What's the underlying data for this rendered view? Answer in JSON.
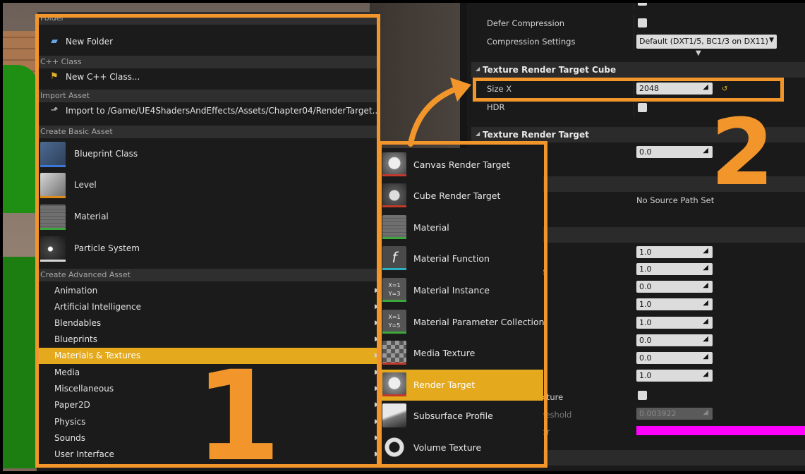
{
  "menu": {
    "sections": {
      "folder": "Folder",
      "cpp_class": "C++ Class",
      "import_asset": "Import Asset",
      "create_basic": "Create Basic Asset",
      "create_advanced": "Create Advanced Asset"
    },
    "new_folder": "New Folder",
    "new_cpp_class": "New C++ Class...",
    "import_to": "Import to /Game/UE4ShadersAndEffects/Assets/Chapter04/RenderTarget...",
    "basic_assets": [
      "Blueprint Class",
      "Level",
      "Material",
      "Particle System"
    ],
    "advanced_categories": [
      "Animation",
      "Artificial Intelligence",
      "Blendables",
      "Blueprints",
      "Materials & Textures",
      "Media",
      "Miscellaneous",
      "Paper2D",
      "Physics",
      "Sounds",
      "User Interface"
    ],
    "selected_category": "Materials & Textures"
  },
  "submenu": {
    "items": [
      "Canvas Render Target",
      "Cube Render Target",
      "Material",
      "Material Function",
      "Material Instance",
      "Material Parameter Collection",
      "Media Texture",
      "Render Target",
      "Subsurface Profile",
      "Volume Texture"
    ],
    "selected": "Render Target"
  },
  "details": {
    "defer_compression": "Defer Compression",
    "compression_settings": "Compression Settings",
    "compression_value": "Default (DXT1/5, BC1/3 on DX11)",
    "cube_category": "Texture Render Target Cube",
    "size_x_label": "Size X",
    "size_x_value": "2048",
    "hdr_label": "HDR",
    "rt_category": "Texture Render Target",
    "rt_value": "0.0",
    "source_path": "No Source Path Set",
    "values": [
      "1.0",
      "1.0",
      "0.0",
      "1.0",
      "1.0",
      "0.0",
      "0.0",
      "1.0"
    ],
    "partial_label_e": "e",
    "partial_texture": "xture",
    "partial_threshold": "reshold",
    "partial_or": "or",
    "threshold_value": "0.003922",
    "color_swatch": "#ff00ff"
  },
  "annotations": {
    "step1": "1",
    "step2": "2",
    "color": "#f2962c"
  },
  "colors": {
    "highlight": "#e4a91d"
  }
}
